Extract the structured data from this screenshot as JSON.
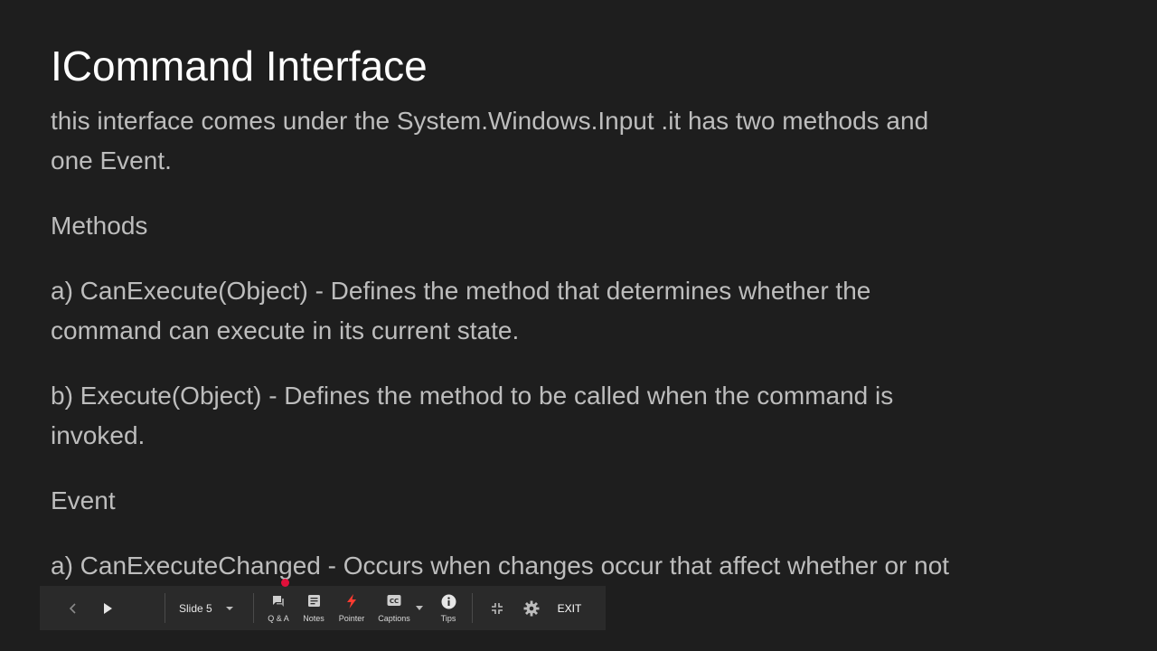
{
  "slide": {
    "title": "ICommand Interface",
    "paragraphs": [
      "this interface comes under the System.Windows.Input .it has two methods and",
      "one Event.",
      "Methods",
      "a) CanExecute(Object) - Defines the method that determines whether the",
      "command can execute in its current state.",
      "b) Execute(Object) - Defines the method to be called when the command is",
      "invoked.",
      "Event",
      "a) CanExecuteChanged - Occurs when changes occur that affect whether or not"
    ]
  },
  "toolbar": {
    "slide_label": "Slide 5",
    "qa_label": "Q & A",
    "notes_label": "Notes",
    "pointer_label": "Pointer",
    "captions_label": "Captions",
    "tips_label": "Tips",
    "exit_label": "EXIT"
  },
  "icons": {
    "prev": "chevron-left-icon",
    "play": "play-icon",
    "slide_menu": "caret-down-icon",
    "qa": "chat-icon",
    "notes": "notes-icon",
    "pointer": "lightning-icon",
    "captions": "cc-icon",
    "captions_menu": "caret-down-icon",
    "tips": "info-icon",
    "exit_fullscreen": "exit-fullscreen-icon",
    "settings": "gear-icon"
  },
  "colors": {
    "background": "#1e1e1e",
    "title": "#ffffff",
    "body_text": "#bdbdbd",
    "toolbar": "#2a2a2a",
    "pointer_accent": "#ff3b30",
    "laser_dot": "#e0103a"
  }
}
